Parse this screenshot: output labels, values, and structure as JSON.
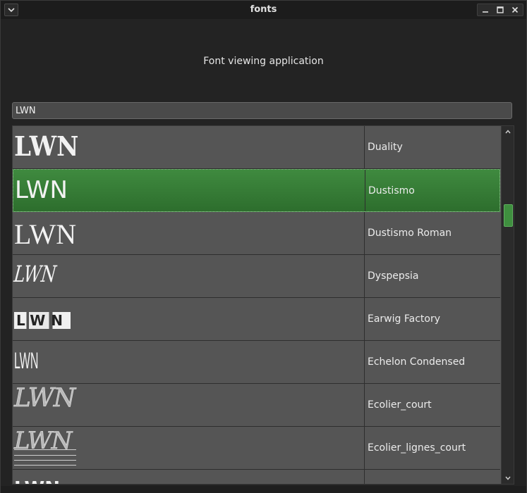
{
  "window": {
    "title": "fonts"
  },
  "subtitle": "Font viewing application",
  "search": {
    "value": "LWN"
  },
  "fonts": [
    {
      "preview": "LWN",
      "name": "Duality"
    },
    {
      "preview": "LWN",
      "name": "Dustismo",
      "selected": true
    },
    {
      "preview": "LWN",
      "name": "Dustismo Roman"
    },
    {
      "preview": "LWN",
      "name": "Dyspepsia"
    },
    {
      "preview": "LWN",
      "name": "Earwig Factory"
    },
    {
      "preview": "LWN",
      "name": "Echelon Condensed"
    },
    {
      "preview": "LWN",
      "name": "Ecolier_court"
    },
    {
      "preview": "LWN",
      "name": "Ecolier_lignes_court"
    },
    {
      "preview": "LWN",
      "name": ""
    }
  ],
  "colors": {
    "selection": "#2f7a2f",
    "row": "#555555",
    "accent": "#3f8f3f"
  },
  "icons": [
    "chevron-down-icon",
    "minimize-icon",
    "maximize-icon",
    "close-icon",
    "scroll-up-icon",
    "scroll-down-icon"
  ]
}
